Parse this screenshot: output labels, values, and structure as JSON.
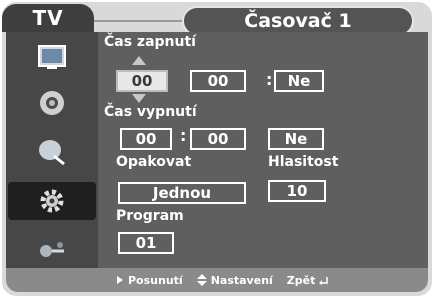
{
  "header": {
    "tv_label": "TV",
    "title": "Časovač 1"
  },
  "sidebar": {
    "items": [
      {
        "icon": "picture-icon"
      },
      {
        "icon": "sound-icon"
      },
      {
        "icon": "channel-icon"
      },
      {
        "icon": "setup-gear-icon",
        "active": true
      },
      {
        "icon": "input-icon"
      }
    ]
  },
  "timer": {
    "on_label": "Čas zapnutí",
    "on_hour": "00",
    "on_minute": "00",
    "on_enabled": "Ne",
    "off_label": "Čas vypnutí",
    "off_hour": "00",
    "off_minute": "00",
    "off_enabled": "Ne",
    "repeat_label": "Opakovat",
    "repeat_value": "Jednou",
    "volume_label": "Hlasitost",
    "volume_value": "10",
    "program_label": "Program",
    "program_value": "01",
    "separator": ":"
  },
  "footer": {
    "move_label": "Posunutí",
    "adjust_label": "Nastavení",
    "back_label": "Zpět"
  },
  "colors": {
    "accent": "#3f3f3f",
    "panel": "#5f5f5f",
    "footer": "#8a8a8a"
  }
}
